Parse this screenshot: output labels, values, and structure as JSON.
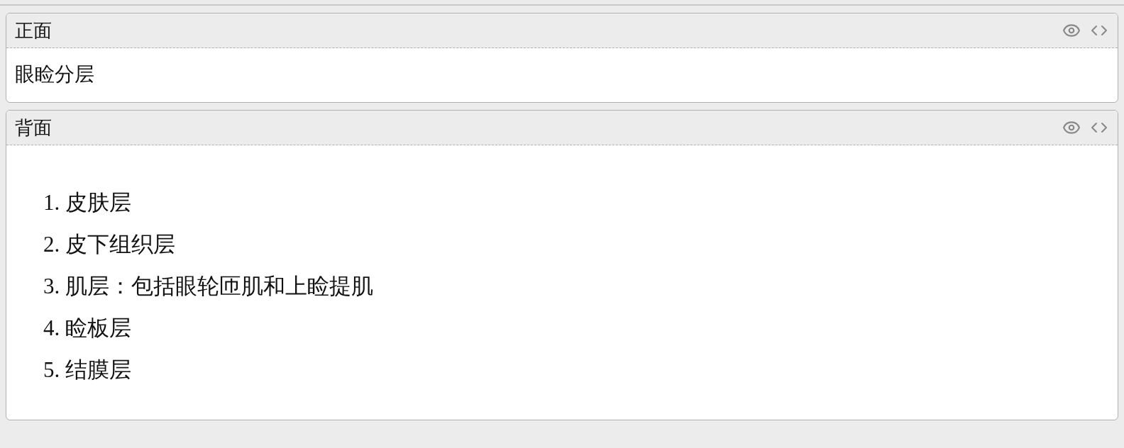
{
  "fields": [
    {
      "name": "正面",
      "kind": "text",
      "text": "眼睑分层"
    },
    {
      "name": "背面",
      "kind": "list",
      "items": [
        {
          "number": "1.",
          "text": "皮肤层"
        },
        {
          "number": "2.",
          "text": "皮下组织层"
        },
        {
          "number": "3.",
          "text": "肌层：包括眼轮匝肌和上睑提肌"
        },
        {
          "number": "4.",
          "text": "睑板层"
        },
        {
          "number": "5.",
          "text": "结膜层"
        }
      ]
    }
  ]
}
